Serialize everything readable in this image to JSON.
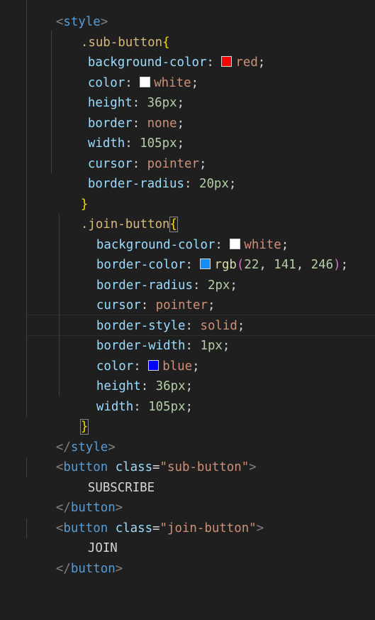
{
  "code": {
    "style_open": {
      "lt": "<",
      "tag": "style",
      "gt": ">"
    },
    "sub_rule": {
      "selector": ".sub-button",
      "open": "{",
      "decls": [
        {
          "prop": "background-color",
          "colon": ": ",
          "value": "red",
          "semi": ";",
          "swatch": "#ff0000"
        },
        {
          "prop": "color",
          "colon": ": ",
          "value": "white",
          "semi": ";",
          "swatch": "#ffffff"
        },
        {
          "prop": "height",
          "colon": ": ",
          "value": "36px",
          "semi": ";"
        },
        {
          "prop": "border",
          "colon": ": ",
          "value": "none",
          "semi": ";"
        },
        {
          "prop": "width",
          "colon": ": ",
          "value": "105px",
          "semi": ";"
        },
        {
          "prop": "cursor",
          "colon": ": ",
          "value": "pointer",
          "semi": ";"
        },
        {
          "prop": "border-radius",
          "colon": ": ",
          "value": "20px",
          "semi": ";"
        }
      ],
      "close": "}"
    },
    "join_rule": {
      "selector": ".join-button",
      "open": "{",
      "decls": [
        {
          "prop": "background-color",
          "colon": ": ",
          "value": "white",
          "semi": ";",
          "swatch": "#ffffff"
        },
        {
          "prop": "border-color",
          "colon": ": ",
          "fn": "rgb",
          "paren_open": "(",
          "args": [
            "22",
            "141",
            "246"
          ],
          "comma": ", ",
          "paren_close": ")",
          "semi": ";",
          "swatch": "#168df6"
        },
        {
          "prop": "border-radius",
          "colon": ": ",
          "value": "2px",
          "semi": ";"
        },
        {
          "prop": "cursor",
          "colon": ": ",
          "value": "pointer",
          "semi": ";"
        },
        {
          "prop": "border-style",
          "colon": ": ",
          "value": "solid",
          "semi": ";"
        },
        {
          "prop": "border-width",
          "colon": ": ",
          "value": "1px",
          "semi": ";"
        },
        {
          "prop": "color",
          "colon": ": ",
          "value": "blue",
          "semi": ";",
          "swatch": "#0000ff"
        },
        {
          "prop": "height",
          "colon": ": ",
          "value": "36px",
          "semi": ";"
        },
        {
          "prop": "width",
          "colon": ": ",
          "value": "105px",
          "semi": ";"
        }
      ],
      "close": "}"
    },
    "style_close": {
      "lt": "</",
      "tag": "style",
      "gt": ">"
    },
    "button1": {
      "lt": "<",
      "tag": "button",
      "space": " ",
      "attr": "class",
      "eq": "=",
      "val": "\"sub-button\"",
      "gt": ">",
      "text": "SUBSCRIBE",
      "close_lt": "</",
      "close_gt": ">"
    },
    "button2": {
      "lt": "<",
      "tag": "button",
      "space": " ",
      "attr": "class",
      "eq": "=",
      "val": "\"join-button\"",
      "gt": ">",
      "text": "JOIN",
      "close_lt": "</",
      "close_gt": ">"
    }
  },
  "colors": {
    "background": "#1f1f1f",
    "tag": "#569cd6",
    "selector": "#d7ba7d",
    "property": "#9cdcfe",
    "value": "#ce9178",
    "number": "#b5cea8",
    "bracket": "#ffd700",
    "paren": "#da70d6"
  }
}
